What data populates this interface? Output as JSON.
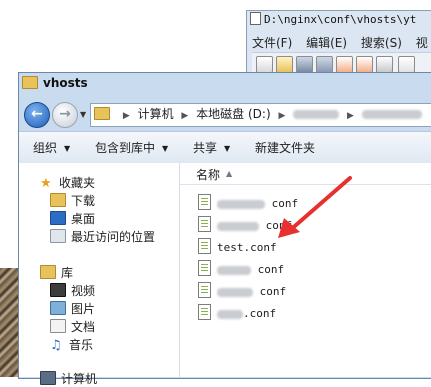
{
  "notepad": {
    "title": "D:\\nginx\\conf\\vhosts\\yt",
    "menu": [
      "文件(F)",
      "编辑(E)",
      "搜索(S)",
      "视"
    ]
  },
  "explorer": {
    "title": "vhosts",
    "address": {
      "items": [
        "计算机",
        "本地磁盘 (D:)"
      ]
    },
    "commands": [
      {
        "label": "组织",
        "has_menu": true
      },
      {
        "label": "包含到库中",
        "has_menu": true
      },
      {
        "label": "共享",
        "has_menu": true
      },
      {
        "label": "新建文件夹",
        "has_menu": false
      }
    ],
    "nav": {
      "favorites_label": "收藏夹",
      "favorites": [
        "下载",
        "桌面",
        "最近访问的位置"
      ],
      "library_label": "库",
      "library": [
        "视频",
        "图片",
        "文档",
        "音乐"
      ],
      "computer_label": "计算机"
    },
    "column_header": "名称",
    "files": [
      {
        "suffix": "conf"
      },
      {
        "suffix": "conf"
      },
      {
        "name": "test.conf"
      },
      {
        "suffix": "conf"
      },
      {
        "suffix": "conf"
      },
      {
        "suffix": ".conf"
      }
    ]
  },
  "colors": {
    "annotation_arrow": "#e8312f",
    "titlebar": "#c9dbef"
  }
}
